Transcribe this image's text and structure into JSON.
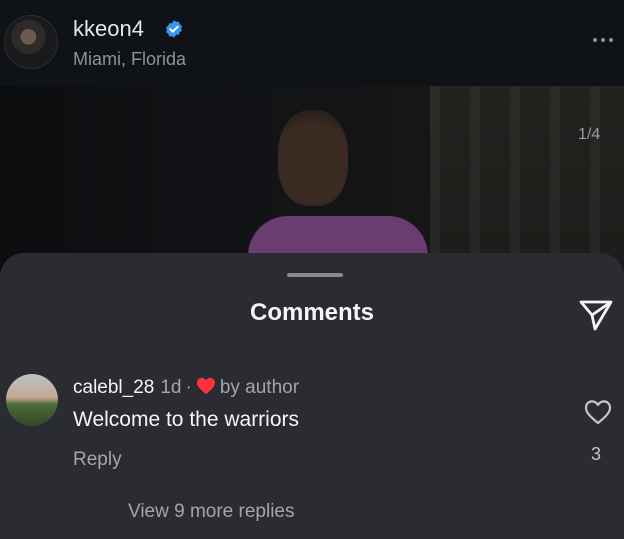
{
  "post": {
    "author": "kkeon4",
    "location": "Miami, Florida",
    "media_counter": "1/4",
    "icons": {
      "verified": "verified-badge-icon",
      "more": "more-options-icon"
    }
  },
  "sheet": {
    "title": "Comments",
    "icons": {
      "share": "send-icon"
    }
  },
  "comment": {
    "username": "calebl_28",
    "time": "1d",
    "separator": "·",
    "liked_by": "by author",
    "text": "Welcome to the warriors",
    "reply_label": "Reply",
    "like_count": "3",
    "view_replies": "View 9 more replies"
  },
  "colors": {
    "accent_verified": "#3797f0",
    "heart": "#ff3040",
    "background": "#1b1d21",
    "sheet": "#2a2c31"
  }
}
